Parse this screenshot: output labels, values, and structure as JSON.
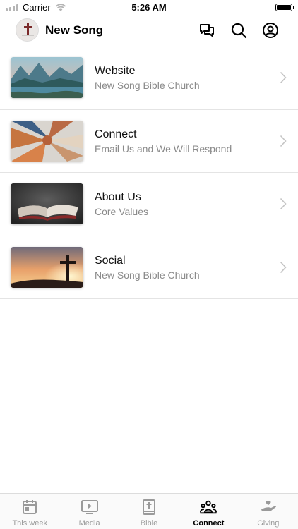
{
  "status_bar": {
    "carrier": "Carrier",
    "time": "5:26 AM"
  },
  "header": {
    "title": "New Song",
    "icons": [
      "chat-icon",
      "search-icon",
      "profile-icon"
    ]
  },
  "items": [
    {
      "title": "Website",
      "subtitle": "New Song Bible Church",
      "image": "mountain-lake-photo"
    },
    {
      "title": "Connect",
      "subtitle": "Email Us and We Will Respond",
      "image": "stacked-hands-photo"
    },
    {
      "title": "About Us",
      "subtitle": "Core Values",
      "image": "open-bible-photo"
    },
    {
      "title": "Social",
      "subtitle": "New Song Bible Church",
      "image": "cross-sunset-photo"
    }
  ],
  "tabs": [
    {
      "label": "This week",
      "icon": "calendar-icon",
      "active": false
    },
    {
      "label": "Media",
      "icon": "play-screen-icon",
      "active": false
    },
    {
      "label": "Bible",
      "icon": "bible-icon",
      "active": false
    },
    {
      "label": "Connect",
      "icon": "people-icon",
      "active": true
    },
    {
      "label": "Giving",
      "icon": "giving-hand-icon",
      "active": false
    }
  ],
  "colors": {
    "accent": "#000000",
    "inactive": "#9a9a9a",
    "divider": "#e4e4e4"
  }
}
